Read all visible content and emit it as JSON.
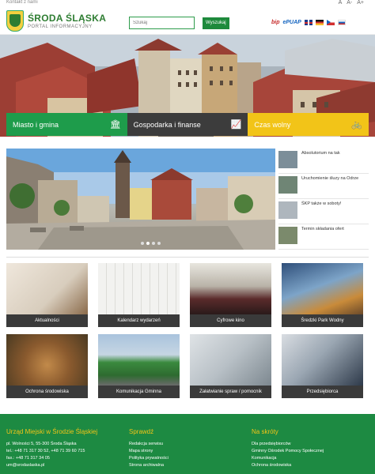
{
  "utility": {
    "contact": "Kontakt z nami",
    "a11y": [
      "A",
      "A-",
      "A+"
    ]
  },
  "header": {
    "title": "ŚRODA ŚLĄSKA",
    "subtitle": "PORTAL INFORMACYJNY",
    "search_placeholder": "Szukaj",
    "search_button": "Wyszukaj",
    "bip": "bip",
    "epuap": "ePUAP"
  },
  "hero_tabs": [
    {
      "label": "Miasto i gmina",
      "icon": "bank-icon",
      "color": "#1e9c4b"
    },
    {
      "label": "Gospodarka i finanse",
      "icon": "chart-up-icon",
      "color": "#3c3c3c"
    },
    {
      "label": "Czas wolny",
      "icon": "bicycle-icon",
      "color": "#f2c418"
    }
  ],
  "news": [
    "Absolutorium na tak",
    "Uruchomienie śluzy na Odrze",
    "ŚKP także w soboty!",
    "Termin składania ofert"
  ],
  "tiles": [
    {
      "label": "Aktualności"
    },
    {
      "label": "Kalendarz wydarzeń"
    },
    {
      "label": "Cyfrowe kino"
    },
    {
      "label": "Średzki Park Wodny"
    },
    {
      "label": "Ochrona środowiska"
    },
    {
      "label": "Komunikacja Gminna"
    },
    {
      "label": "Załatwianie spraw / pomocnik"
    },
    {
      "label": "Przedsiębiorca"
    }
  ],
  "footer": {
    "office": {
      "title": "Urząd Miejski w Środzie Śląskiej",
      "lines": [
        "pl. Wolności 5, 55-300 Środa Śląska",
        "tel.: +48 71 317 30 52, +48 71 39 60 715",
        "fax.: +48 71 317 34 05",
        "um@srodaslaska.pl"
      ]
    },
    "check": {
      "title": "Sprawdź",
      "lines": [
        "Redakcja serwisu",
        "Mapa strony",
        "Polityka prywatności",
        "Strona archiwalna"
      ]
    },
    "shortcuts": {
      "title": "Na skróty",
      "lines": [
        "Dla przedsiębiorców",
        "Gminny Ośrodek Pomocy Społecznej",
        "Komunikacja",
        "Ochrona środowiska"
      ]
    }
  },
  "colors": {
    "green": "#1e9c4b",
    "dark": "#3c3c3c",
    "yellow": "#f2c418",
    "footer": "#1d8a42"
  }
}
